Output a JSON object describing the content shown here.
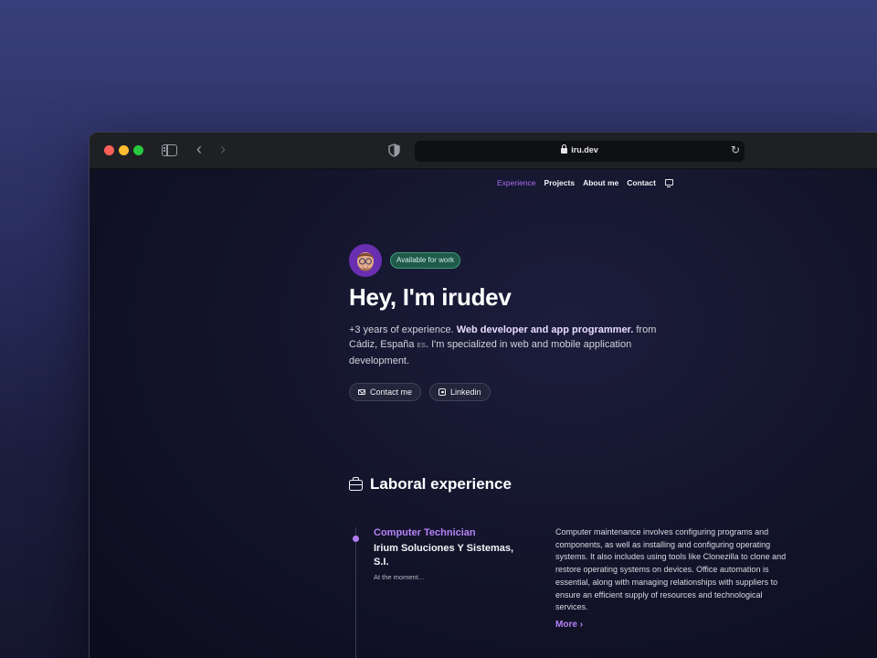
{
  "browser": {
    "url": "iru.dev"
  },
  "nav": {
    "items": [
      {
        "label": "Experience",
        "active": true
      },
      {
        "label": "Projects",
        "active": false
      },
      {
        "label": "About me",
        "active": false
      },
      {
        "label": "Contact",
        "active": false
      }
    ],
    "theme_icon": "monitor-icon"
  },
  "hero": {
    "badge": "Available for work",
    "title": "Hey, I'm irudev",
    "intro_prefix": "+3 years of experience. ",
    "intro_highlight": "Web developer and app programmer.",
    "location_prefix": " from Cádiz, España ",
    "country_code": "ES",
    "location_suffix": ". I'm specialized in web and mobile application development.",
    "buttons": [
      {
        "label": "Contact me",
        "icon": "mail-icon"
      },
      {
        "label": "Linkedin",
        "icon": "linkedin-icon"
      }
    ]
  },
  "experience": {
    "title": "Laboral experience",
    "jobs": [
      {
        "role": "Computer Technician",
        "company": "Irium Soluciones Y Sistemas, S.I.",
        "date": "At the moment...",
        "description": "Computer maintenance involves configuring programs and components, as well as installing and configuring operating systems. It also includes using tools like Clonezilla to clone and restore operating systems on devices. Office automation is essential, along with managing relationships with suppliers to ensure an efficient supply of resources and technological services.",
        "more_label": "More"
      }
    ]
  },
  "colors": {
    "accent": "#b482f6",
    "badge_bg": "#1f5a4a",
    "background": "#121328"
  }
}
